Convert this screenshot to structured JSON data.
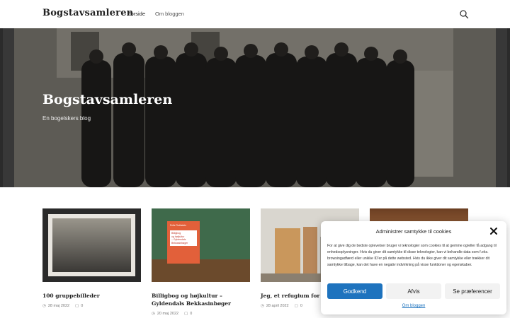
{
  "header": {
    "site_title": "Bogstavsamleren",
    "nav": [
      {
        "label": "Forside",
        "active": true
      },
      {
        "label": "Om bloggen",
        "active": false
      }
    ],
    "search_icon": "search-icon"
  },
  "hero": {
    "title": "Bogstavsamleren",
    "subtitle": "En bogelskers blog"
  },
  "posts": [
    {
      "title": "100 gruppebilleder",
      "date": "28 maj 2022",
      "comments": "0"
    },
    {
      "title": "Billigbog og højkultur – Gyldendals Bekkasinbøger",
      "date": "20 maj 2022",
      "comments": "0"
    },
    {
      "title": "Jeg, et refugium for d… bogbind",
      "date": "28 april 2022",
      "comments": "0"
    },
    {
      "title": "",
      "date": "",
      "comments": ""
    }
  ],
  "book_cover": {
    "author": "Felix Rothstein",
    "title_lines": [
      "Billigbog",
      "og højkultur",
      "– Gyldendals",
      "Bekkasinbøger"
    ]
  },
  "consent": {
    "title": "Administrer samtykke til cookies",
    "text": "For at give dig de bedste oplevelser bruger vi teknologier som cookies til at gemme og/eller få adgang til enhedsoplysninger. Hvis du giver dit samtykke til disse teknologier, kan vi behandle data som f.eks. browsingadfærd eller unikke ID'er på dette websted. Hvis du ikke giver dit samtykke eller trækker dit samtykke tilbage, kan det have en negativ indvirkning på visse funktioner og egenskaber.",
    "accept_label": "Godkend",
    "deny_label": "Afvis",
    "prefs_label": "Se præferencer",
    "link_label": "Om bloggen"
  },
  "colors": {
    "accent": "#1e73be"
  }
}
